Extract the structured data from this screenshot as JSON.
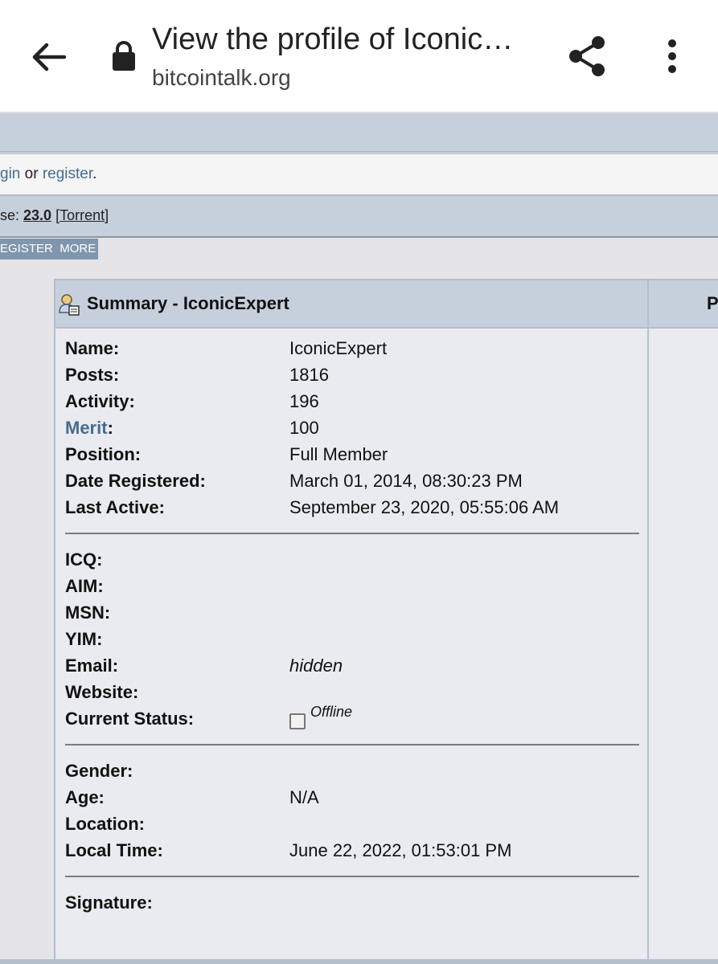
{
  "browser": {
    "title": "View the profile of Iconic…",
    "url": "bitcointalk.org"
  },
  "login_bar": {
    "prefix": "gin",
    "middle": " or ",
    "register": "register",
    "suffix": "."
  },
  "release_bar": {
    "prefix": "se: ",
    "version": "23.0",
    "open": " [",
    "torrent": "Torrent",
    "close": "]"
  },
  "menu": {
    "items": [
      "EGISTER",
      "MORE"
    ]
  },
  "profile": {
    "header": "Summary - IconicExpert",
    "right_header": "P",
    "section1": [
      {
        "label": "Name:",
        "value": "IconicExpert"
      },
      {
        "label": "Posts:",
        "value": "1816"
      },
      {
        "label": "Activity:",
        "value": "196"
      },
      {
        "label": "Merit",
        "label_suffix": ":",
        "value": "100"
      },
      {
        "label": "Position:",
        "value": "Full Member"
      },
      {
        "label": "Date Registered:",
        "value": "March 01, 2014, 08:30:23 PM"
      },
      {
        "label": "Last Active:",
        "value": "September 23, 2020, 05:55:06 AM"
      }
    ],
    "section2": [
      {
        "label": "ICQ:",
        "value": ""
      },
      {
        "label": "AIM:",
        "value": ""
      },
      {
        "label": "MSN:",
        "value": ""
      },
      {
        "label": "YIM:",
        "value": ""
      },
      {
        "label": "Email:",
        "value": "hidden"
      },
      {
        "label": "Website:",
        "value": ""
      },
      {
        "label": "Current Status:",
        "value": "Offline"
      }
    ],
    "section3": [
      {
        "label": "Gender:",
        "value": ""
      },
      {
        "label": "Age:",
        "value": "N/A"
      },
      {
        "label": "Location:",
        "value": ""
      },
      {
        "label": "Local Time:",
        "value": "June 22, 2022, 01:53:01 PM"
      }
    ],
    "section4": [
      {
        "label": "Signature:",
        "value": ""
      }
    ]
  },
  "icons": [
    "back-arrow-icon",
    "lock-icon",
    "share-icon",
    "more-vert-icon",
    "profile-summary-icon",
    "status-offline-icon"
  ]
}
